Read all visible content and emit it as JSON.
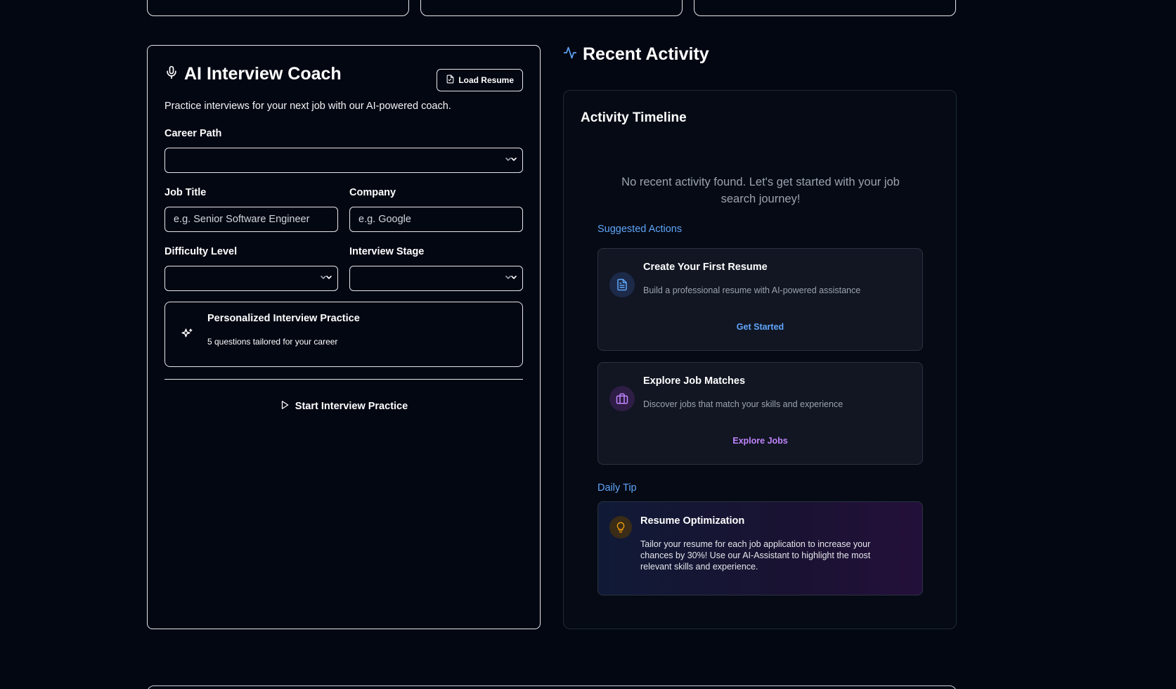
{
  "coach": {
    "title": "AI Interview Coach",
    "load_resume_label": "Load Resume",
    "description": "Practice interviews for your next job with our AI-powered coach.",
    "career_path_label": "Career Path",
    "career_path_value": "",
    "job_title_label": "Job Title",
    "job_title_placeholder": "e.g. Senior Software Engineer",
    "company_label": "Company",
    "company_placeholder": "e.g. Google",
    "difficulty_label": "Difficulty Level",
    "difficulty_value": "",
    "stage_label": "Interview Stage",
    "stage_value": "",
    "practice_title": "Personalized Interview Practice",
    "practice_subtitle": "5 questions tailored for your career",
    "start_label": "Start Interview Practice"
  },
  "activity": {
    "heading": "Recent Activity",
    "timeline_title": "Activity Timeline",
    "empty_message": "No recent activity found. Let's get started with your job search journey!",
    "suggested_label": "Suggested Actions",
    "suggestions": [
      {
        "title": "Create Your First Resume",
        "description": "Build a professional resume with AI-powered assistance",
        "link": "Get Started",
        "icon": "document-icon",
        "accent": "#60a5fa"
      },
      {
        "title": "Explore Job Matches",
        "description": "Discover jobs that match your skills and experience",
        "link": "Explore Jobs",
        "icon": "briefcase-icon",
        "accent": "#c084fc"
      }
    ],
    "tip_label": "Daily Tip",
    "tip": {
      "title": "Resume Optimization",
      "text": "Tailor your resume for each job application to increase your chances by 30%! Use our AI-Assistant to highlight the most relevant skills and experience.",
      "icon": "lightbulb-icon",
      "accent": "#f59e0b"
    }
  }
}
